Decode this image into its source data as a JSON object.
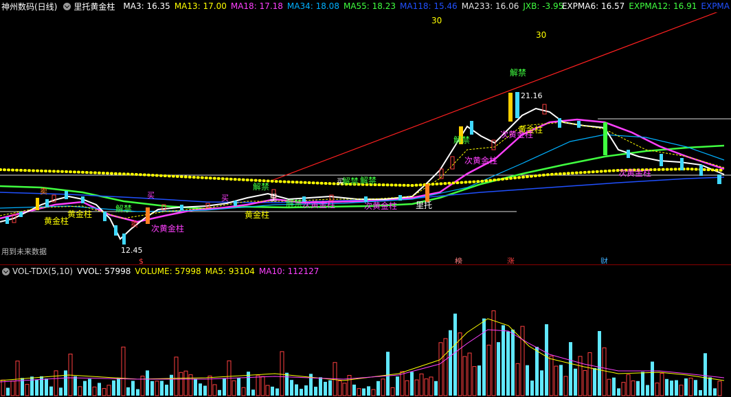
{
  "header": {
    "stock_name": "神州数码(日线)",
    "indicator_name": "里托黄金柱",
    "ma_values": [
      {
        "label": "MA3: 16.35",
        "color": "#ffffff"
      },
      {
        "label": "MA13: 17.00",
        "color": "#ffff00"
      },
      {
        "label": "MA18: 17.18",
        "color": "#ff40ff"
      },
      {
        "label": "MA34: 18.08",
        "color": "#00b0ff"
      },
      {
        "label": "MA55: 18.23",
        "color": "#40ff40"
      },
      {
        "label": "MA118: 15.46",
        "color": "#2050ff"
      },
      {
        "label": "MA233: 16.06",
        "color": "#e0e0e0"
      },
      {
        "label": "JXB: -3.95",
        "color": "#40ff40"
      }
    ],
    "expma": [
      {
        "label": "EXPMA6: 16.57",
        "color": "#ffffff"
      },
      {
        "label": "EXPMA12: 16.91",
        "color": "#40ff40"
      },
      {
        "label": "EXPMA",
        "color": "#2050ff"
      }
    ]
  },
  "price_chart": {
    "labels": {
      "thirty_a": "30",
      "thirty_b": "30",
      "high_price": "21.16",
      "low_price": "12.45",
      "jiejin_top": "解禁",
      "jiejin_1": "解禁",
      "jiejin_2": "解禁",
      "jiejin_3": "解禁",
      "jiejin_4": "解禁",
      "jiejin_5": "解禁",
      "jiejin_6": "解禁",
      "gold_1": "黄金柱",
      "gold_2": "黄金柱",
      "gold_3": "黄金柱",
      "gold_4": "黄金柱",
      "sub_gold_1": "次黄金柱",
      "sub_gold_2": "次黄金柱",
      "sub_gold_3": "次黄金柱",
      "sub_gold_4": "次黄金柱",
      "sub_gold_5": "次黄金柱",
      "sub_gold_6": "次黄金柱",
      "litou": "里托",
      "li": "里",
      "buy_1": "买",
      "buy_2": "买",
      "buy_3": "买",
      "sell_1": "卖",
      "sell_2": "卖",
      "future_data": "用到未来数据",
      "marker_s": "$",
      "marker_bang": "榜",
      "marker_zhang": "涨",
      "marker_cai": "财"
    }
  },
  "volume_panel": {
    "header_name": "VOL-TDX(5,10)",
    "values": [
      {
        "label": "VVOL: 57998",
        "color": "#ffffff"
      },
      {
        "label": "VOLUME: 57998",
        "color": "#ffff00"
      },
      {
        "label": "MA5: 93104",
        "color": "#ffff00"
      },
      {
        "label": "MA10: 112127",
        "color": "#ff40ff"
      }
    ]
  }
}
